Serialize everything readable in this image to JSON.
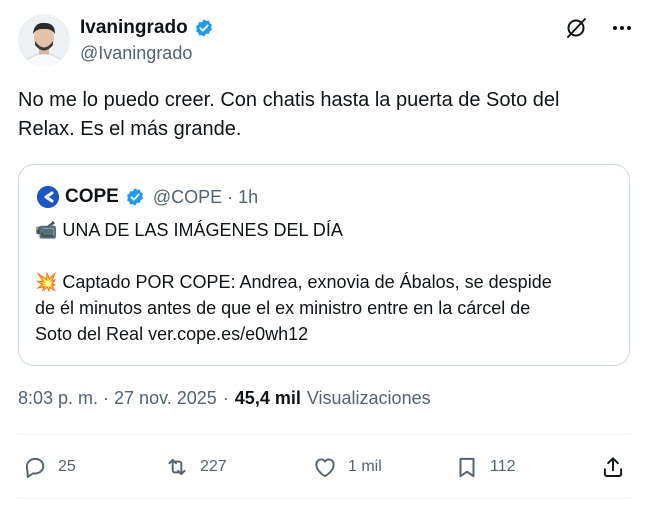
{
  "tweet": {
    "author": {
      "display_name": "Ivaningrado",
      "handle": "@Ivaningrado"
    },
    "text_line1": "No me lo puedo creer. Con chatis hasta la puerta de Soto del",
    "text_line2": "Relax. Es el más grande.",
    "quote": {
      "display_name": "COPE",
      "meta": "@COPE · 1h",
      "line1": "📹 UNA DE LAS IMÁGENES DEL DÍA",
      "line2": "💥 Captado POR COPE: Andrea, exnovia de Ábalos, se despide",
      "line3": "de él minutos antes de que el ex ministro entre en la cárcel de",
      "line4": "Soto del Real ver.cope.es/e0wh12"
    },
    "timestamp": "8:03 p. m. · 27 nov. 2025",
    "dot": "·",
    "views_count": "45,4 mil",
    "views_label": "Visualizaciones",
    "actions": {
      "replies": "25",
      "retweets": "227",
      "likes": "1 mil",
      "bookmarks": "112"
    }
  },
  "colors": {
    "verified": "#1d9bf0",
    "text_secondary": "#536471",
    "border": "#cfd9de",
    "cope_blue": "#1a56c4"
  }
}
